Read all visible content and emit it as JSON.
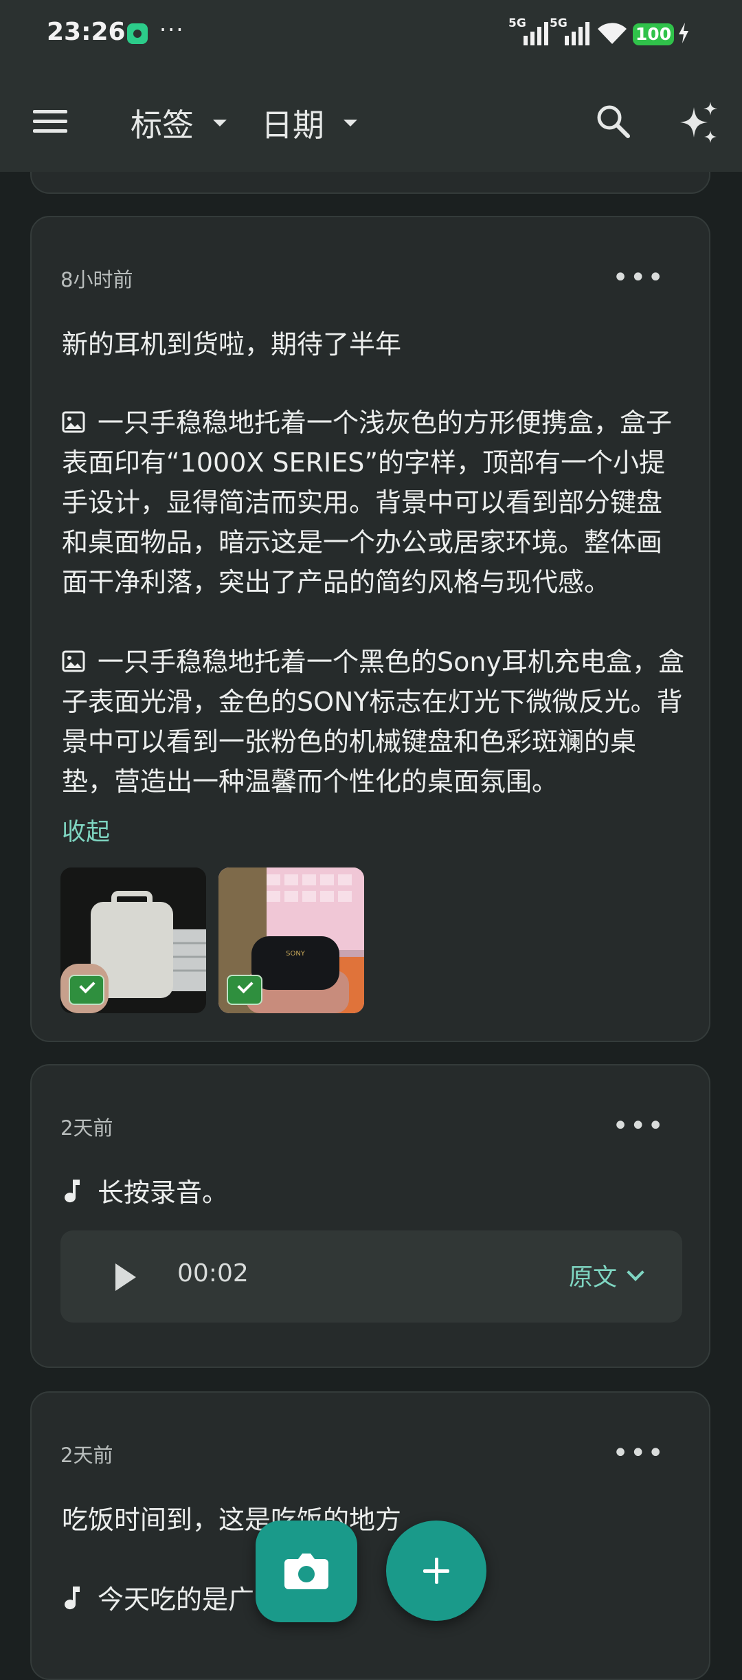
{
  "status_bar": {
    "time": "23:26",
    "more": "···",
    "signal1": "5G",
    "signal2": "5G",
    "battery": "100"
  },
  "toolbar": {
    "tags_label": "标签",
    "date_label": "日期"
  },
  "notes": [
    {
      "time": "8小时前",
      "text": "新的耳机到货啦，期待了半年",
      "image_desc_1": "一只手稳稳地托着一个浅灰色的方形便携盒，盒子表面印有“1000X SERIES”的字样，顶部有一个小提手设计，显得简洁而实用。背景中可以看到部分键盘和桌面物品，暗示这是一个办公或居家环境。整体画面干净利落，突出了产品的简约风格与现代感。",
      "image_desc_2": "一只手稳稳地托着一个黑色的Sony耳机充电盒，盒子表面光滑，金色的SONY标志在灯光下微微反光。背景中可以看到一张粉色的机械键盘和色彩斑斓的桌垫，营造出一种温馨而个性化的桌面氛围。",
      "collapse_label": "收起"
    },
    {
      "time": "2天前",
      "text": "长按录音。",
      "audio_duration": "00:02",
      "original_label": "原文"
    },
    {
      "time": "2天前",
      "text": "吃饭时间到，这是吃饭的地方",
      "audio_text": "今天吃的是广"
    }
  ],
  "colors": {
    "accent": "#1a9a8a",
    "link": "#7fd6c2",
    "background": "#1b2020",
    "card": "#262b2b"
  }
}
